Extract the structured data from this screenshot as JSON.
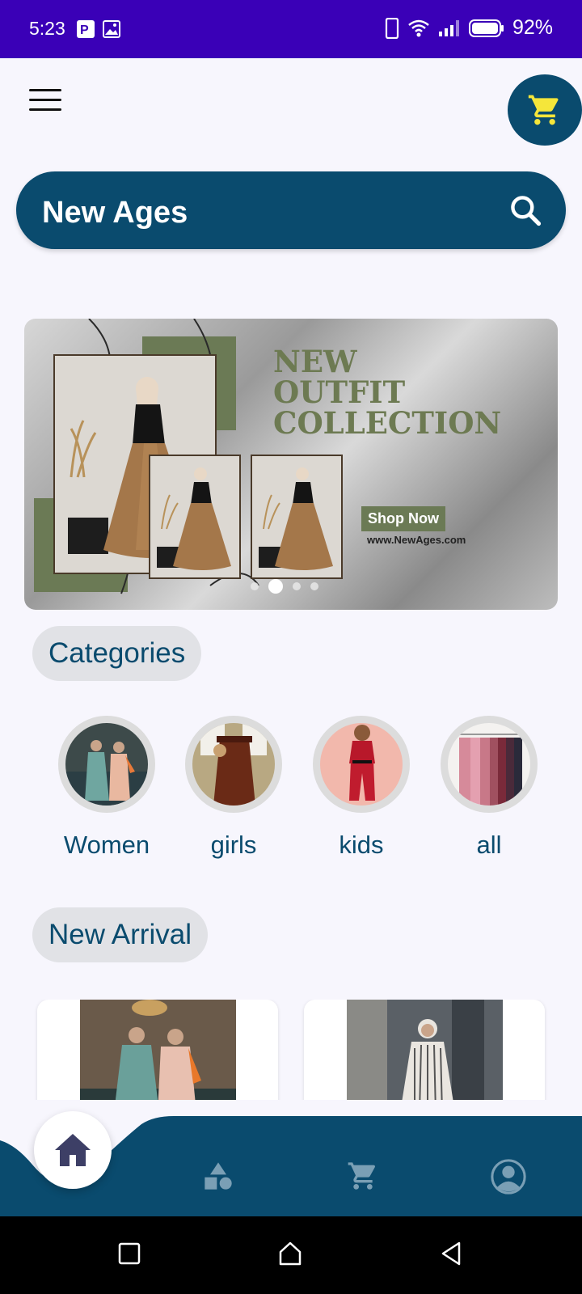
{
  "status_bar": {
    "time": "5:23",
    "battery": "92%",
    "icons": [
      "p-app-icon",
      "image-icon",
      "phone-icon",
      "wifi-icon",
      "signal-icon",
      "battery-icon"
    ]
  },
  "header": {
    "menu_icon": "hamburger-menu-icon",
    "cart_icon": "cart-icon",
    "cart_icon_color": "#f5e63a"
  },
  "search": {
    "title": "New Ages",
    "icon": "search-icon"
  },
  "banner": {
    "heading_line1": "NEW",
    "heading_line2": "OUTFIT",
    "heading_line3": "COLLECTION",
    "button_label": "Shop Now",
    "url": "www.NewAges.com",
    "slides_count": 4,
    "active_slide": 2
  },
  "categories": {
    "title": "Categories",
    "items": [
      {
        "label": "Women"
      },
      {
        "label": "girls"
      },
      {
        "label": "kids"
      },
      {
        "label": "all"
      }
    ]
  },
  "new_arrival": {
    "title": "New Arrival"
  },
  "bottom_nav": {
    "items": [
      "home-icon",
      "shapes-icon",
      "cart-icon",
      "profile-icon"
    ],
    "active": "home-icon"
  },
  "colors": {
    "primary": "#0a4b6e",
    "status_bar": "#3a00b7",
    "background": "#f7f6fd",
    "banner_accent": "#6b7a55"
  }
}
